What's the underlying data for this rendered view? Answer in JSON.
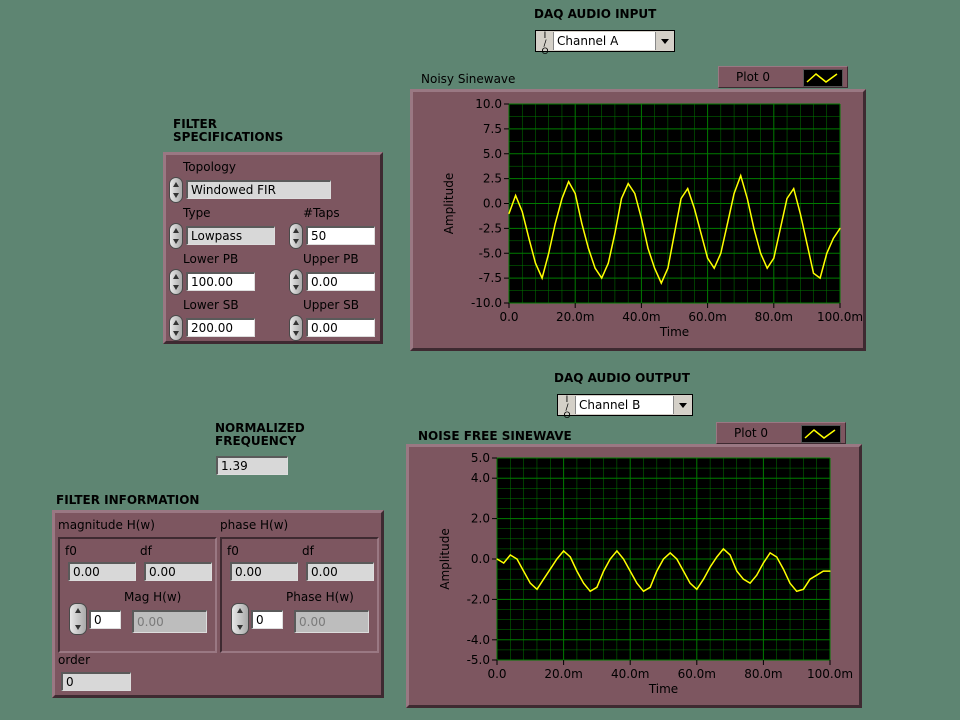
{
  "daq_in": {
    "title": "DAQ AUDIO INPUT",
    "io_label": "I/O",
    "channel": "Channel A"
  },
  "daq_out": {
    "title": "DAQ AUDIO OUTPUT",
    "io_label": "I/O",
    "channel": "Channel B"
  },
  "filter_spec": {
    "title_line1": "FILTER",
    "title_line2": "SPECIFICATIONS",
    "topology_label": "Topology",
    "topology_value": "Windowed FIR",
    "type_label": "Type",
    "type_value": "Lowpass",
    "taps_label": "#Taps",
    "taps_value": "50",
    "lower_pb_label": "Lower PB",
    "lower_pb_value": "100.00",
    "upper_pb_label": "Upper PB",
    "upper_pb_value": "0.00",
    "lower_sb_label": "Lower SB",
    "lower_sb_value": "200.00",
    "upper_sb_label": "Upper SB",
    "upper_sb_value": "0.00"
  },
  "normalized": {
    "title_line1": "NORMALIZED",
    "title_line2": "FREQUENCY",
    "value": "1.39"
  },
  "filter_info": {
    "title": "FILTER INFORMATION",
    "magnitude": {
      "label": "magnitude H(w)",
      "f0_label": "f0",
      "f0_value": "0.00",
      "df_label": "df",
      "df_value": "0.00",
      "index_value": "0",
      "mag_label": "Mag H(w)",
      "mag_value": "0.00"
    },
    "phase": {
      "label": "phase H(w)",
      "f0_label": "f0",
      "f0_value": "0.00",
      "df_label": "df",
      "df_value": "0.00",
      "index_value": "0",
      "phase_label": "Phase H(w)",
      "phase_value": "0.00"
    },
    "order_label": "order",
    "order_value": "0"
  },
  "colors": {
    "background": "#5e8572",
    "panel": "#7d5660",
    "plot_bg": "#000000",
    "grid": "#007a00",
    "trace": "#ffff00"
  },
  "chart_data": [
    {
      "type": "line",
      "title": "Noisy Sinewave",
      "xlabel": "Time",
      "ylabel": "Amplitude",
      "legend": "Plot 0",
      "xlim": [
        0,
        0.1
      ],
      "ylim": [
        -10,
        10
      ],
      "xticks": [
        "0.0",
        "20.0m",
        "40.0m",
        "60.0m",
        "80.0m",
        "100.0m"
      ],
      "yticks": [
        "10.0",
        "7.5",
        "5.0",
        "2.5",
        "0.0",
        "-2.5",
        "-5.0",
        "-7.5",
        "-10.0"
      ],
      "grid": true,
      "series": [
        {
          "name": "Plot 0",
          "color": "#ffff00",
          "x": [
            0.0,
            0.002,
            0.004,
            0.006,
            0.008,
            0.01,
            0.012,
            0.014,
            0.016,
            0.018,
            0.02,
            0.022,
            0.024,
            0.026,
            0.028,
            0.03,
            0.032,
            0.034,
            0.036,
            0.038,
            0.04,
            0.042,
            0.044,
            0.046,
            0.048,
            0.05,
            0.052,
            0.054,
            0.056,
            0.058,
            0.06,
            0.062,
            0.064,
            0.066,
            0.068,
            0.07,
            0.072,
            0.074,
            0.076,
            0.078,
            0.08,
            0.082,
            0.084,
            0.086,
            0.088,
            0.09,
            0.092,
            0.094,
            0.096,
            0.098,
            0.1
          ],
          "y": [
            -1.0,
            0.8,
            -0.8,
            -3.5,
            -6.0,
            -7.5,
            -5.0,
            -2.0,
            0.5,
            2.2,
            1.0,
            -2.0,
            -4.5,
            -6.5,
            -7.5,
            -6.0,
            -3.0,
            0.5,
            2.0,
            1.0,
            -1.5,
            -4.5,
            -6.5,
            -8.0,
            -6.5,
            -3.0,
            0.5,
            1.5,
            -0.5,
            -3.0,
            -5.5,
            -6.5,
            -5.0,
            -2.0,
            1.0,
            2.8,
            0.5,
            -2.5,
            -5.0,
            -6.5,
            -5.5,
            -2.5,
            0.5,
            1.5,
            -1.0,
            -4.0,
            -7.0,
            -7.5,
            -5.0,
            -3.5,
            -2.5
          ]
        }
      ]
    },
    {
      "type": "line",
      "title": "NOISE FREE SINEWAVE",
      "xlabel": "Time",
      "ylabel": "Amplitude",
      "legend": "Plot 0",
      "xlim": [
        0,
        100
      ],
      "ylim": [
        -5,
        5
      ],
      "xticks": [
        "0.0",
        "20.0m",
        "40.0m",
        "60.0m",
        "80.0m",
        "100.0m"
      ],
      "yticks": [
        "5.0",
        "4.0",
        "2.0",
        "0.0",
        "-2.0",
        "-4.0",
        "-5.0"
      ],
      "grid": true,
      "series": [
        {
          "name": "Plot 0",
          "color": "#ffff00",
          "x": [
            0,
            2,
            4,
            6,
            8,
            10,
            12,
            14,
            16,
            18,
            20,
            22,
            24,
            26,
            28,
            30,
            32,
            34,
            36,
            38,
            40,
            42,
            44,
            46,
            48,
            50,
            52,
            54,
            56,
            58,
            60,
            62,
            64,
            66,
            68,
            70,
            72,
            74,
            76,
            78,
            80,
            82,
            84,
            86,
            88,
            90,
            92,
            94,
            96,
            98,
            100
          ],
          "y": [
            0.0,
            -0.2,
            0.2,
            0.0,
            -0.6,
            -1.2,
            -1.5,
            -1.0,
            -0.5,
            0.0,
            0.4,
            0.1,
            -0.6,
            -1.2,
            -1.6,
            -1.4,
            -0.6,
            0.0,
            0.4,
            0.0,
            -0.6,
            -1.2,
            -1.6,
            -1.4,
            -0.6,
            0.0,
            0.3,
            0.0,
            -0.6,
            -1.2,
            -1.5,
            -1.0,
            -0.4,
            0.1,
            0.5,
            0.2,
            -0.6,
            -1.0,
            -1.2,
            -0.8,
            -0.2,
            0.3,
            0.1,
            -0.5,
            -1.2,
            -1.6,
            -1.5,
            -1.0,
            -0.8,
            -0.6,
            -0.6
          ]
        }
      ]
    }
  ]
}
